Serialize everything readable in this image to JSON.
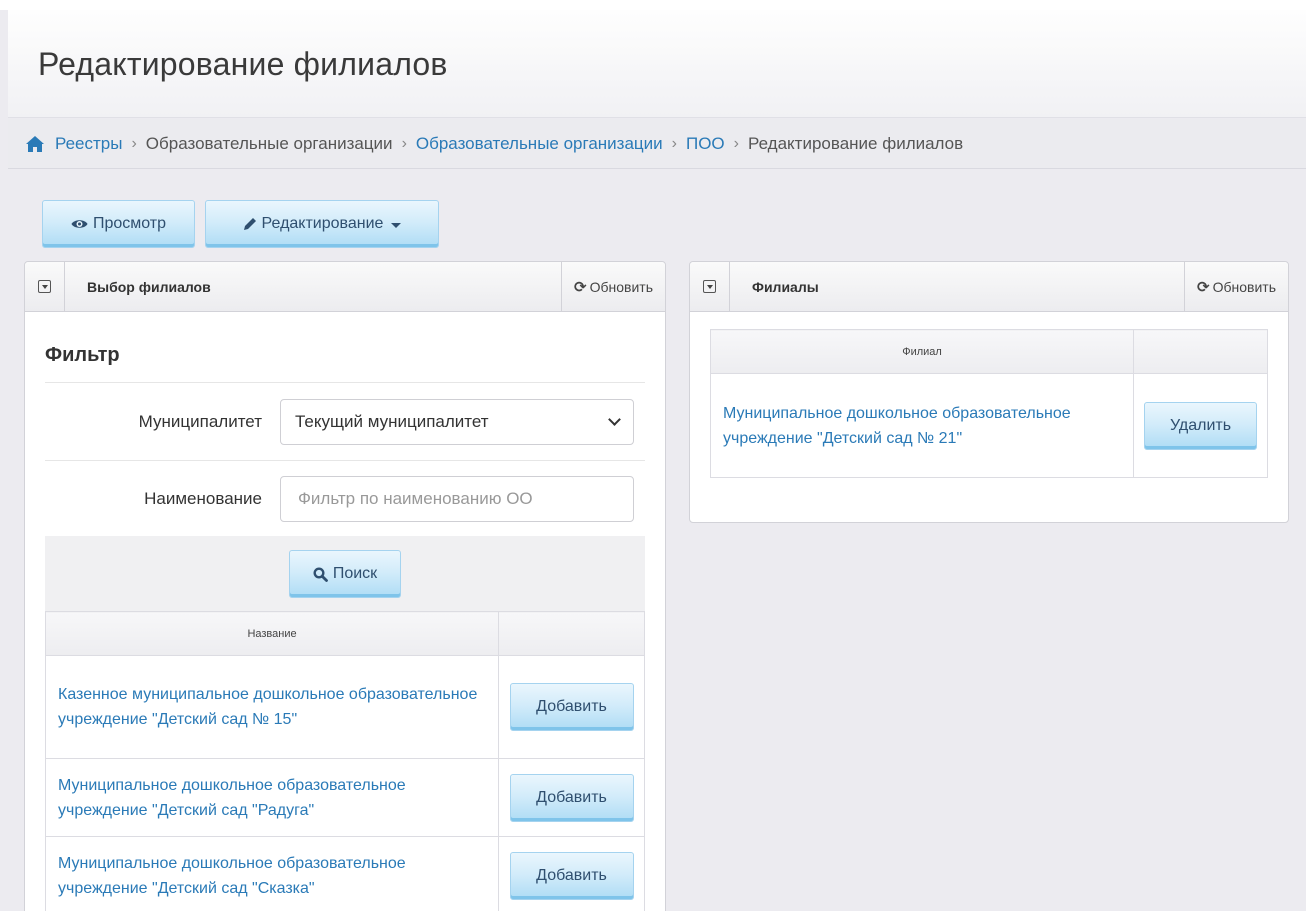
{
  "page": {
    "title": "Редактирование филиалов"
  },
  "breadcrumb": {
    "items": [
      {
        "label": "Реестры",
        "link": true
      },
      {
        "label": "Образовательные организации",
        "link": false
      },
      {
        "label": "Образовательные организации",
        "link": true
      },
      {
        "label": "ПОО",
        "link": true
      },
      {
        "label": "Редактирование филиалов",
        "link": false
      }
    ]
  },
  "toolbar": {
    "view_label": "Просмотр",
    "edit_label": "Редактирование"
  },
  "left_panel": {
    "title": "Выбор филиалов",
    "refresh_label": "Обновить",
    "filter": {
      "title": "Фильтр",
      "municipality_label": "Муниципалитет",
      "municipality_value": "Текущий муниципалитет",
      "name_label": "Наименование",
      "name_placeholder": "Фильтр по наименованию ОО",
      "search_label": "Поиск"
    },
    "table": {
      "header_name": "Название",
      "header_action": "",
      "rows": [
        {
          "name": "Казенное муниципальное дошкольное образовательное учреждение \"Детский сад № 15\"",
          "action": "Добавить"
        },
        {
          "name": "Муниципальное дошкольное образовательное учреждение \"Детский сад \"Радуга\"",
          "action": "Добавить"
        },
        {
          "name": "Муниципальное дошкольное образовательное учреждение \"Детский сад \"Сказка\"",
          "action": "Добавить"
        }
      ]
    }
  },
  "right_panel": {
    "title": "Филиалы",
    "refresh_label": "Обновить",
    "table": {
      "header_name": "Филиал",
      "header_action": "",
      "rows": [
        {
          "name": "Муниципальное дошкольное образовательное учреждение \"Детский сад № 21\"",
          "action": "Удалить"
        }
      ]
    }
  },
  "icons": {
    "home": "home-icon",
    "eye": "eye-icon",
    "pencil": "pencil-icon",
    "refresh": "refresh-icon",
    "search": "search-icon",
    "collapse": "collapse-icon"
  },
  "colors": {
    "link": "#2a7ab7",
    "button_top": "#eaf6fd",
    "button_bottom": "#aedcf5"
  }
}
